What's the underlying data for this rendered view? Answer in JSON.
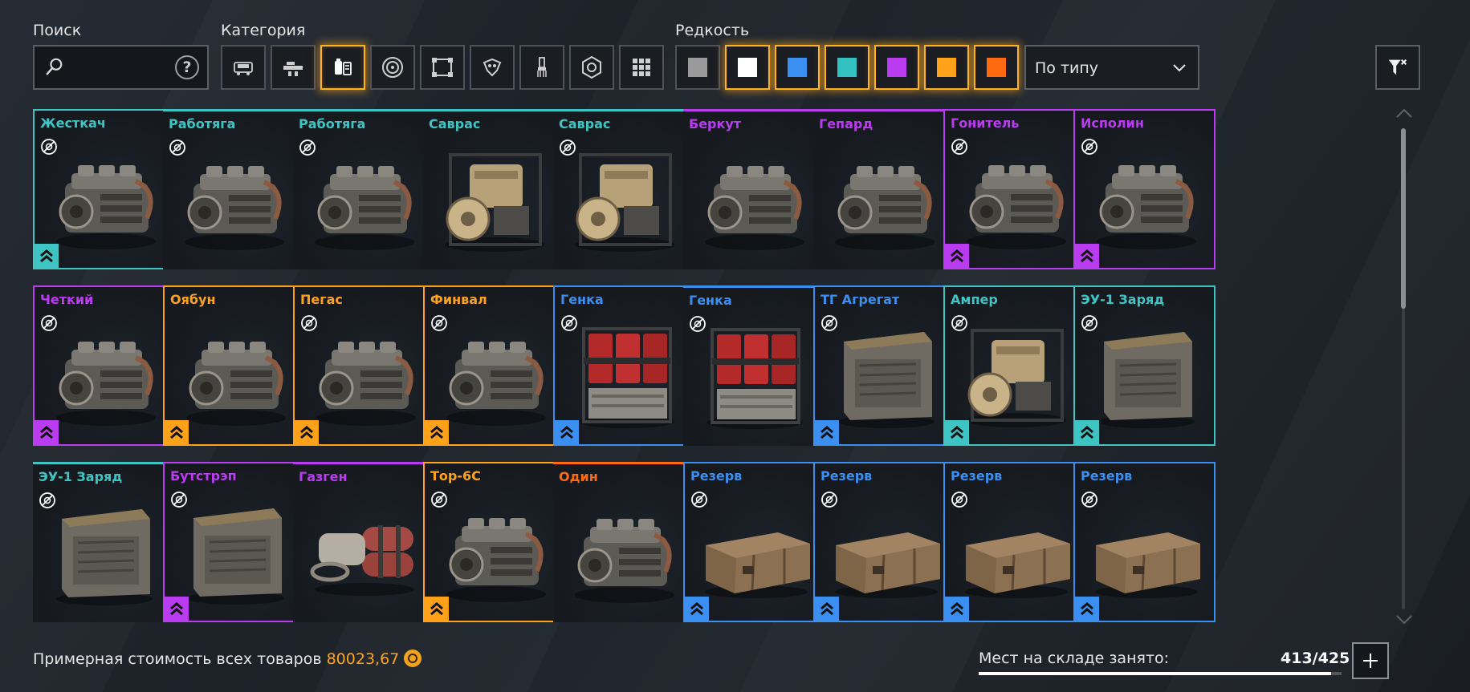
{
  "search": {
    "label": "Поиск",
    "value": "",
    "icon": "magnifier-icon",
    "help_icon": "?"
  },
  "category": {
    "label": "Категория",
    "buttons": [
      {
        "name": "cabins",
        "icon": "cabin-icon",
        "active": false
      },
      {
        "name": "weapons",
        "icon": "weapon-icon",
        "active": false
      },
      {
        "name": "hardware",
        "icon": "engine-icon",
        "active": true
      },
      {
        "name": "wheels",
        "icon": "wheel-icon",
        "active": false
      },
      {
        "name": "frames",
        "icon": "frame-icon",
        "active": false
      },
      {
        "name": "decor",
        "icon": "decor-icon",
        "active": false
      },
      {
        "name": "paint",
        "icon": "brush-icon",
        "active": false
      },
      {
        "name": "resources",
        "icon": "gear-hex-icon",
        "active": false
      },
      {
        "name": "all",
        "icon": "grid-icon",
        "active": false
      }
    ]
  },
  "rarity": {
    "label": "Редкость",
    "buttons": [
      {
        "name": "common",
        "color": "#9a9a9a",
        "active": false
      },
      {
        "name": "ordinary",
        "color": "#ffffff",
        "active": true
      },
      {
        "name": "rare",
        "color": "#3a8ff0",
        "active": true
      },
      {
        "name": "special",
        "color": "#33c0c0",
        "active": true
      },
      {
        "name": "epic",
        "color": "#b93cf0",
        "active": true
      },
      {
        "name": "legendary",
        "color": "#ffa21a",
        "active": true
      },
      {
        "name": "relic",
        "color": "#ff6a10",
        "active": true
      }
    ]
  },
  "sort": {
    "value": "По типу"
  },
  "items": [
    {
      "name": "Жесткач",
      "color": "#3fc4c4",
      "style": "bordered",
      "noicon": true,
      "badge": true,
      "art": "engine"
    },
    {
      "name": "Работяга",
      "color": "#3fc4c4",
      "style": "topline",
      "noicon": true,
      "badge": false,
      "art": "engine"
    },
    {
      "name": "Работяга",
      "color": "#3fc4c4",
      "style": "topline",
      "noicon": true,
      "badge": false,
      "art": "engine"
    },
    {
      "name": "Саврас",
      "color": "#3fc4c4",
      "style": "topline",
      "noicon": false,
      "badge": false,
      "art": "frame-engine"
    },
    {
      "name": "Саврас",
      "color": "#3fc4c4",
      "style": "topline",
      "noicon": true,
      "badge": false,
      "art": "frame-engine"
    },
    {
      "name": "Беркут",
      "color": "#b93cf0",
      "style": "topline",
      "noicon": false,
      "badge": false,
      "art": "engine"
    },
    {
      "name": "Гепард",
      "color": "#b93cf0",
      "style": "topline",
      "noicon": false,
      "badge": false,
      "art": "engine"
    },
    {
      "name": "Гонитель",
      "color": "#b93cf0",
      "style": "bordered",
      "noicon": true,
      "badge": true,
      "art": "engine"
    },
    {
      "name": "Исполин",
      "color": "#b93cf0",
      "style": "bordered",
      "noicon": true,
      "badge": true,
      "art": "engine"
    },
    {
      "name": "Четкий",
      "color": "#b93cf0",
      "style": "bordered",
      "noicon": true,
      "badge": true,
      "art": "engine"
    },
    {
      "name": "Оябун",
      "color": "#ffa21a",
      "style": "bordered",
      "noicon": false,
      "badge": true,
      "art": "engine"
    },
    {
      "name": "Пегас",
      "color": "#ffa21a",
      "style": "bordered",
      "noicon": true,
      "badge": true,
      "art": "engine"
    },
    {
      "name": "Финвал",
      "color": "#ffa21a",
      "style": "bordered",
      "noicon": true,
      "badge": true,
      "art": "engine"
    },
    {
      "name": "Генка",
      "color": "#3a8ff0",
      "style": "bordered",
      "noicon": true,
      "badge": true,
      "art": "canisters"
    },
    {
      "name": "Генка",
      "color": "#3a8ff0",
      "style": "topline",
      "noicon": true,
      "badge": false,
      "art": "canisters"
    },
    {
      "name": "ТГ Агрегат",
      "color": "#3a8ff0",
      "style": "bordered",
      "noicon": true,
      "badge": true,
      "art": "generator"
    },
    {
      "name": "Ампер",
      "color": "#3fc4c4",
      "style": "bordered",
      "noicon": true,
      "badge": true,
      "art": "frame-engine"
    },
    {
      "name": "ЭУ-1 Заряд",
      "color": "#3fc4c4",
      "style": "bordered",
      "noicon": true,
      "badge": true,
      "art": "generator"
    },
    {
      "name": "ЭУ-1 Заряд",
      "color": "#3fc4c4",
      "style": "topline",
      "noicon": true,
      "badge": false,
      "art": "generator"
    },
    {
      "name": "Бутстрэп",
      "color": "#b93cf0",
      "style": "bordered",
      "noicon": true,
      "badge": true,
      "art": "generator"
    },
    {
      "name": "Газген",
      "color": "#b93cf0",
      "style": "topline",
      "noicon": false,
      "badge": false,
      "art": "gasgen"
    },
    {
      "name": "Тор-6С",
      "color": "#ffa21a",
      "style": "bordered",
      "noicon": true,
      "badge": true,
      "art": "engine"
    },
    {
      "name": "Один",
      "color": "#ff6a10",
      "style": "topline",
      "noicon": false,
      "badge": false,
      "art": "engine"
    },
    {
      "name": "Резерв",
      "color": "#3a8ff0",
      "style": "bordered",
      "noicon": true,
      "badge": true,
      "art": "crate"
    },
    {
      "name": "Резерв",
      "color": "#3a8ff0",
      "style": "bordered",
      "noicon": true,
      "badge": true,
      "art": "crate"
    },
    {
      "name": "Резерв",
      "color": "#3a8ff0",
      "style": "bordered",
      "noicon": true,
      "badge": true,
      "art": "crate"
    },
    {
      "name": "Резерв",
      "color": "#3a8ff0",
      "style": "bordered",
      "noicon": true,
      "badge": true,
      "art": "crate"
    }
  ],
  "footer": {
    "total_label": "Примерная стоимость всех товаров",
    "total_value": "80023,67",
    "storage_label": "Мест на складе занято:",
    "storage_value": "413/425",
    "storage_fraction": 0.9718
  }
}
